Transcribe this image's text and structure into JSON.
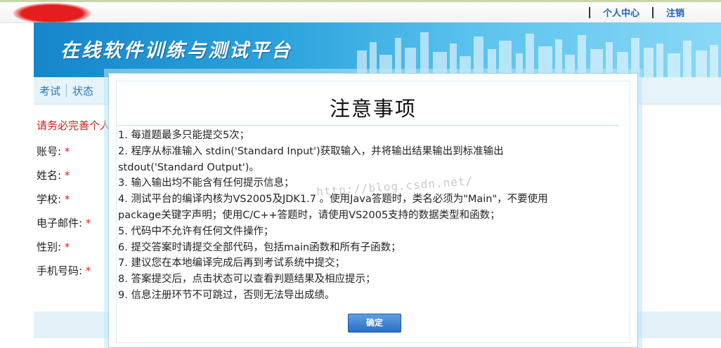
{
  "header": {
    "links": [
      {
        "label": "个人中心"
      },
      {
        "label": "注销"
      }
    ]
  },
  "banner": {
    "title": "在线软件训练与测试平台"
  },
  "nav": {
    "items": [
      "考试",
      "状态"
    ]
  },
  "form": {
    "warning": "请务必完善个人",
    "fields": [
      {
        "label": "账号:",
        "required": "*"
      },
      {
        "label": "姓名:",
        "required": "*"
      },
      {
        "label": "学校:",
        "required": "*"
      },
      {
        "label": "电子邮件:",
        "required": "*"
      },
      {
        "label": "性别:",
        "required": "*"
      },
      {
        "label": "手机号码:",
        "required": "*"
      }
    ]
  },
  "modal": {
    "title": "注意事项",
    "rules": [
      "1. 每道题最多只能提交5次；",
      "2. 程序从标准输入 stdin('Standard Input')获取输入，并将输出结果输出到标准输出",
      "stdout('Standard Output')。",
      "3. 输入输出均不能含有任何提示信息；",
      "4. 测试平台的编译内核为VS2005及JDK1.7 。使用Java答题时，类名必须为\"Main\"，不要使用",
      "package关键字声明；使用C/C++答题时，请使用VS2005支持的数据类型和函数；",
      "5. 代码中不允许有任何文件操作；",
      "6. 提交答案时请提交全部代码，包括main函数和所有子函数；",
      "7. 建议您在本地编译完成后再到考试系统中提交；",
      "8. 答案提交后，点击状态可以查看判题结果及相应提示；",
      "9. 信息注册环节不可跳过，否则无法导出成绩。"
    ],
    "watermark": "http://blog.csdn.net/",
    "ok_label": "确定"
  },
  "colors": {
    "link": "#1b63b8",
    "banner": "#2aa2dc",
    "required": "#e51a1a",
    "button": "#2a6fc4"
  }
}
